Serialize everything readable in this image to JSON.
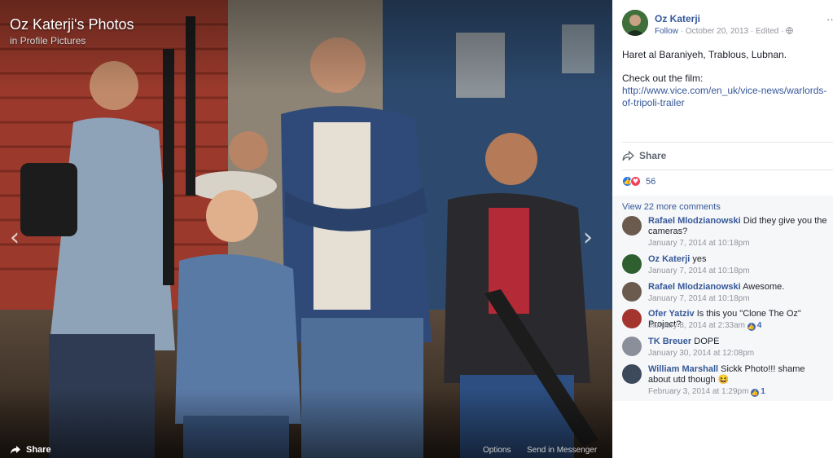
{
  "viewer": {
    "title": "Oz Katerji's Photos",
    "album": "in Profile Pictures",
    "share_label": "Share",
    "options_label": "Options",
    "messenger_label": "Send in Messenger",
    "prev_glyph": "‹",
    "next_glyph": "›"
  },
  "post": {
    "author": "Oz Katerji",
    "follow_label": "Follow",
    "date": "October 20, 2013",
    "edited_label": "Edited",
    "separator": "·",
    "more_glyph": "···",
    "caption": "Haret al Baraniyeh, Trablous, Lubnan.",
    "film_intro": "Check out the film:",
    "film_link": "http://www.vice.com/en_uk/vice-news/warlords-of-tripoli-trailer",
    "share_label": "Share",
    "reaction_count": "56"
  },
  "comments": {
    "view_more": "View 22 more comments",
    "items": [
      {
        "name": "Rafael Mlodzianowski",
        "text": "Did they give you the cameras?",
        "time": "January 7, 2014 at 10:18pm",
        "likes": "",
        "avatar_color": "#6b5b4e"
      },
      {
        "name": "Oz Katerji",
        "text": "yes",
        "time": "January 7, 2014 at 10:18pm",
        "likes": "",
        "avatar_color": "#2f5e2f"
      },
      {
        "name": "Rafael Mlodzianowski",
        "text": "Awesome.",
        "time": "January 7, 2014 at 10:18pm",
        "likes": "",
        "avatar_color": "#6b5b4e"
      },
      {
        "name": "Ofer Yatziv",
        "text": "Is this you \"Clone The Oz\" Project?",
        "time": "January 8, 2014 at 2:33am",
        "likes": "4",
        "avatar_color": "#a3342e"
      },
      {
        "name": "TK Breuer",
        "text": "DOPE",
        "time": "January 30, 2014 at 12:08pm",
        "likes": "",
        "avatar_color": "#8a8f99"
      },
      {
        "name": "William Marshall",
        "text": "Sickk Photo!!! shame about utd though 😆",
        "time": "February 3, 2014 at 1:29pm",
        "likes": "1",
        "avatar_color": "#3d4a5c"
      }
    ]
  },
  "icons": {
    "share": "share-arrow-icon",
    "like": "like-thumb-icon",
    "love": "love-heart-icon",
    "globe": "globe-icon"
  },
  "colors": {
    "link": "#365899",
    "meta": "#90949c",
    "comments_bg": "#f6f7f9"
  }
}
